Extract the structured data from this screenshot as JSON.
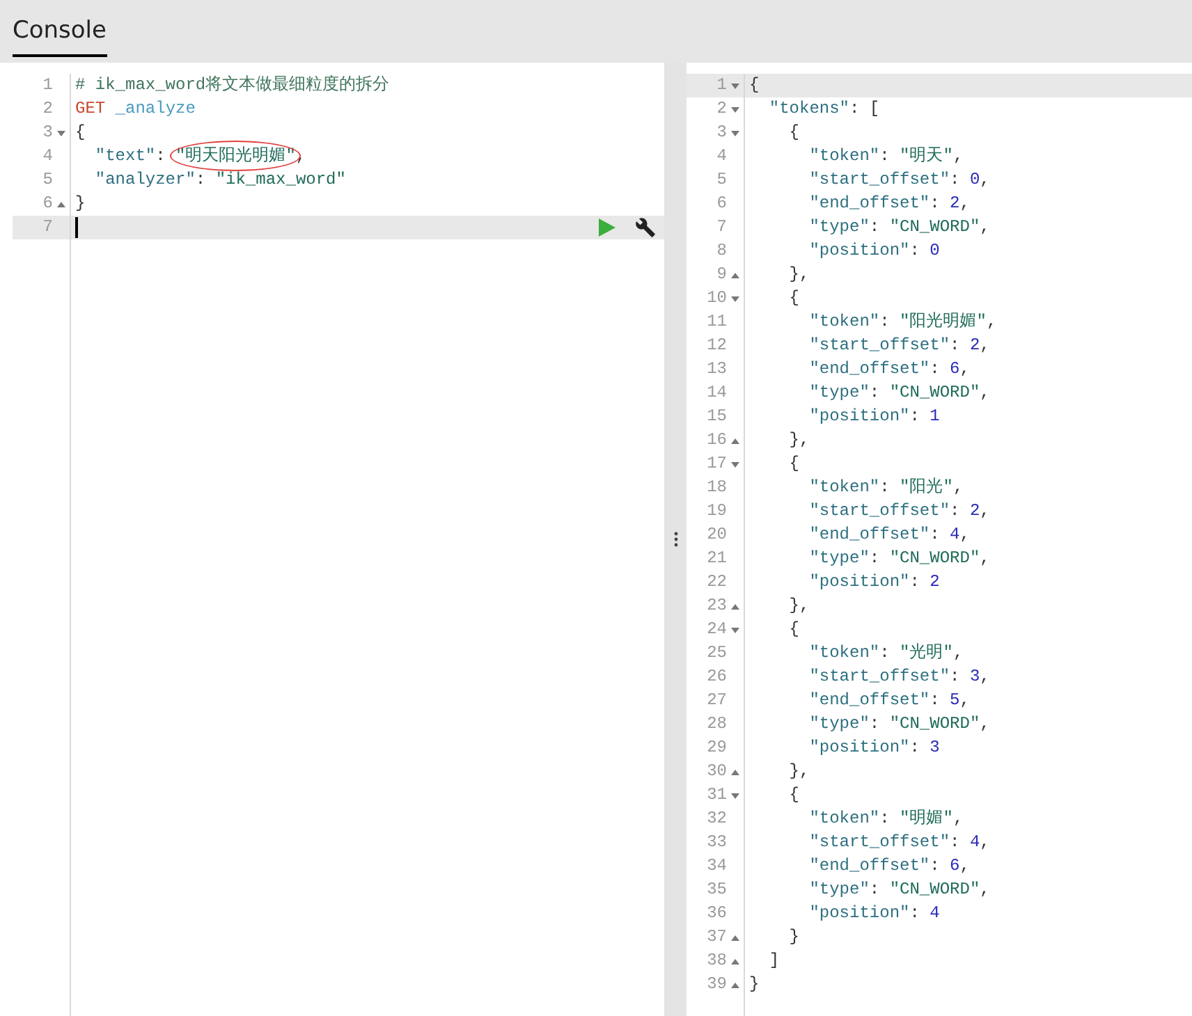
{
  "tabs": [
    {
      "label": "Console",
      "selected": true
    }
  ],
  "request_editor": {
    "lines": [
      {
        "number": "1",
        "fold_start": false,
        "fold_end": false,
        "active": false,
        "segments": [
          {
            "text": "# ik_max_word将文本做最细粒度的拆分",
            "kind": "comment"
          }
        ]
      },
      {
        "number": "2",
        "fold_start": false,
        "fold_end": false,
        "active": false,
        "segments": [
          {
            "text": "GET",
            "kind": "method"
          },
          {
            "text": " _analyze",
            "kind": "url"
          }
        ]
      },
      {
        "number": "3",
        "fold_start": true,
        "fold_end": false,
        "active": false,
        "segments": [
          {
            "text": "{",
            "kind": "punct"
          }
        ]
      },
      {
        "number": "4",
        "fold_start": false,
        "fold_end": false,
        "active": false,
        "segments": [
          {
            "text": "  \"text\"",
            "kind": "key"
          },
          {
            "text": ": ",
            "kind": "punct"
          },
          {
            "text": "\"明天阳光明媚\"",
            "kind": "string",
            "circled": true
          },
          {
            "text": ",",
            "kind": "punct"
          }
        ]
      },
      {
        "number": "5",
        "fold_start": false,
        "fold_end": false,
        "active": false,
        "segments": [
          {
            "text": "  \"analyzer\"",
            "kind": "key"
          },
          {
            "text": ": ",
            "kind": "punct"
          },
          {
            "text": "\"ik_max_word\"",
            "kind": "string"
          }
        ]
      },
      {
        "number": "6",
        "fold_start": false,
        "fold_end": true,
        "active": false,
        "segments": [
          {
            "text": "}",
            "kind": "punct"
          }
        ]
      },
      {
        "number": "7",
        "fold_start": false,
        "fold_end": false,
        "active": true
      }
    ]
  },
  "response_editor": {
    "lines": [
      {
        "number": "1",
        "fold_start": true,
        "fold_end": false,
        "active": true,
        "segments": [
          {
            "text": "{",
            "kind": "punct"
          }
        ]
      },
      {
        "number": "2",
        "fold_start": true,
        "fold_end": false,
        "active": false,
        "segments": [
          {
            "text": "  \"tokens\"",
            "kind": "key"
          },
          {
            "text": ": [",
            "kind": "punct"
          }
        ]
      },
      {
        "number": "3",
        "fold_start": true,
        "fold_end": false,
        "active": false,
        "segments": [
          {
            "text": "    {",
            "kind": "punct"
          }
        ]
      },
      {
        "number": "4",
        "fold_start": false,
        "fold_end": false,
        "active": false,
        "segments": [
          {
            "text": "      \"token\"",
            "kind": "key"
          },
          {
            "text": ": ",
            "kind": "punct"
          },
          {
            "text": "\"明天\"",
            "kind": "string"
          },
          {
            "text": ",",
            "kind": "punct"
          }
        ]
      },
      {
        "number": "5",
        "fold_start": false,
        "fold_end": false,
        "active": false,
        "segments": [
          {
            "text": "      \"start_offset\"",
            "kind": "key"
          },
          {
            "text": ": ",
            "kind": "punct"
          },
          {
            "text": "0",
            "kind": "number"
          },
          {
            "text": ",",
            "kind": "punct"
          }
        ]
      },
      {
        "number": "6",
        "fold_start": false,
        "fold_end": false,
        "active": false,
        "segments": [
          {
            "text": "      \"end_offset\"",
            "kind": "key"
          },
          {
            "text": ": ",
            "kind": "punct"
          },
          {
            "text": "2",
            "kind": "number"
          },
          {
            "text": ",",
            "kind": "punct"
          }
        ]
      },
      {
        "number": "7",
        "fold_start": false,
        "fold_end": false,
        "active": false,
        "segments": [
          {
            "text": "      \"type\"",
            "kind": "key"
          },
          {
            "text": ": ",
            "kind": "punct"
          },
          {
            "text": "\"CN_WORD\"",
            "kind": "string"
          },
          {
            "text": ",",
            "kind": "punct"
          }
        ]
      },
      {
        "number": "8",
        "fold_start": false,
        "fold_end": false,
        "active": false,
        "segments": [
          {
            "text": "      \"position\"",
            "kind": "key"
          },
          {
            "text": ": ",
            "kind": "punct"
          },
          {
            "text": "0",
            "kind": "number"
          }
        ]
      },
      {
        "number": "9",
        "fold_start": false,
        "fold_end": true,
        "active": false,
        "segments": [
          {
            "text": "    },",
            "kind": "punct"
          }
        ]
      },
      {
        "number": "10",
        "fold_start": true,
        "fold_end": false,
        "active": false,
        "segments": [
          {
            "text": "    {",
            "kind": "punct"
          }
        ]
      },
      {
        "number": "11",
        "fold_start": false,
        "fold_end": false,
        "active": false,
        "segments": [
          {
            "text": "      \"token\"",
            "kind": "key"
          },
          {
            "text": ": ",
            "kind": "punct"
          },
          {
            "text": "\"阳光明媚\"",
            "kind": "string"
          },
          {
            "text": ",",
            "kind": "punct"
          }
        ]
      },
      {
        "number": "12",
        "fold_start": false,
        "fold_end": false,
        "active": false,
        "segments": [
          {
            "text": "      \"start_offset\"",
            "kind": "key"
          },
          {
            "text": ": ",
            "kind": "punct"
          },
          {
            "text": "2",
            "kind": "number"
          },
          {
            "text": ",",
            "kind": "punct"
          }
        ]
      },
      {
        "number": "13",
        "fold_start": false,
        "fold_end": false,
        "active": false,
        "segments": [
          {
            "text": "      \"end_offset\"",
            "kind": "key"
          },
          {
            "text": ": ",
            "kind": "punct"
          },
          {
            "text": "6",
            "kind": "number"
          },
          {
            "text": ",",
            "kind": "punct"
          }
        ]
      },
      {
        "number": "14",
        "fold_start": false,
        "fold_end": false,
        "active": false,
        "segments": [
          {
            "text": "      \"type\"",
            "kind": "key"
          },
          {
            "text": ": ",
            "kind": "punct"
          },
          {
            "text": "\"CN_WORD\"",
            "kind": "string"
          },
          {
            "text": ",",
            "kind": "punct"
          }
        ]
      },
      {
        "number": "15",
        "fold_start": false,
        "fold_end": false,
        "active": false,
        "segments": [
          {
            "text": "      \"position\"",
            "kind": "key"
          },
          {
            "text": ": ",
            "kind": "punct"
          },
          {
            "text": "1",
            "kind": "number"
          }
        ]
      },
      {
        "number": "16",
        "fold_start": false,
        "fold_end": true,
        "active": false,
        "segments": [
          {
            "text": "    },",
            "kind": "punct"
          }
        ]
      },
      {
        "number": "17",
        "fold_start": true,
        "fold_end": false,
        "active": false,
        "segments": [
          {
            "text": "    {",
            "kind": "punct"
          }
        ]
      },
      {
        "number": "18",
        "fold_start": false,
        "fold_end": false,
        "active": false,
        "segments": [
          {
            "text": "      \"token\"",
            "kind": "key"
          },
          {
            "text": ": ",
            "kind": "punct"
          },
          {
            "text": "\"阳光\"",
            "kind": "string"
          },
          {
            "text": ",",
            "kind": "punct"
          }
        ]
      },
      {
        "number": "19",
        "fold_start": false,
        "fold_end": false,
        "active": false,
        "segments": [
          {
            "text": "      \"start_offset\"",
            "kind": "key"
          },
          {
            "text": ": ",
            "kind": "punct"
          },
          {
            "text": "2",
            "kind": "number"
          },
          {
            "text": ",",
            "kind": "punct"
          }
        ]
      },
      {
        "number": "20",
        "fold_start": false,
        "fold_end": false,
        "active": false,
        "segments": [
          {
            "text": "      \"end_offset\"",
            "kind": "key"
          },
          {
            "text": ": ",
            "kind": "punct"
          },
          {
            "text": "4",
            "kind": "number"
          },
          {
            "text": ",",
            "kind": "punct"
          }
        ]
      },
      {
        "number": "21",
        "fold_start": false,
        "fold_end": false,
        "active": false,
        "segments": [
          {
            "text": "      \"type\"",
            "kind": "key"
          },
          {
            "text": ": ",
            "kind": "punct"
          },
          {
            "text": "\"CN_WORD\"",
            "kind": "string"
          },
          {
            "text": ",",
            "kind": "punct"
          }
        ]
      },
      {
        "number": "22",
        "fold_start": false,
        "fold_end": false,
        "active": false,
        "segments": [
          {
            "text": "      \"position\"",
            "kind": "key"
          },
          {
            "text": ": ",
            "kind": "punct"
          },
          {
            "text": "2",
            "kind": "number"
          }
        ]
      },
      {
        "number": "23",
        "fold_start": false,
        "fold_end": true,
        "active": false,
        "segments": [
          {
            "text": "    },",
            "kind": "punct"
          }
        ]
      },
      {
        "number": "24",
        "fold_start": true,
        "fold_end": false,
        "active": false,
        "segments": [
          {
            "text": "    {",
            "kind": "punct"
          }
        ]
      },
      {
        "number": "25",
        "fold_start": false,
        "fold_end": false,
        "active": false,
        "segments": [
          {
            "text": "      \"token\"",
            "kind": "key"
          },
          {
            "text": ": ",
            "kind": "punct"
          },
          {
            "text": "\"光明\"",
            "kind": "string"
          },
          {
            "text": ",",
            "kind": "punct"
          }
        ]
      },
      {
        "number": "26",
        "fold_start": false,
        "fold_end": false,
        "active": false,
        "segments": [
          {
            "text": "      \"start_offset\"",
            "kind": "key"
          },
          {
            "text": ": ",
            "kind": "punct"
          },
          {
            "text": "3",
            "kind": "number"
          },
          {
            "text": ",",
            "kind": "punct"
          }
        ]
      },
      {
        "number": "27",
        "fold_start": false,
        "fold_end": false,
        "active": false,
        "segments": [
          {
            "text": "      \"end_offset\"",
            "kind": "key"
          },
          {
            "text": ": ",
            "kind": "punct"
          },
          {
            "text": "5",
            "kind": "number"
          },
          {
            "text": ",",
            "kind": "punct"
          }
        ]
      },
      {
        "number": "28",
        "fold_start": false,
        "fold_end": false,
        "active": false,
        "segments": [
          {
            "text": "      \"type\"",
            "kind": "key"
          },
          {
            "text": ": ",
            "kind": "punct"
          },
          {
            "text": "\"CN_WORD\"",
            "kind": "string"
          },
          {
            "text": ",",
            "kind": "punct"
          }
        ]
      },
      {
        "number": "29",
        "fold_start": false,
        "fold_end": false,
        "active": false,
        "segments": [
          {
            "text": "      \"position\"",
            "kind": "key"
          },
          {
            "text": ": ",
            "kind": "punct"
          },
          {
            "text": "3",
            "kind": "number"
          }
        ]
      },
      {
        "number": "30",
        "fold_start": false,
        "fold_end": true,
        "active": false,
        "segments": [
          {
            "text": "    },",
            "kind": "punct"
          }
        ]
      },
      {
        "number": "31",
        "fold_start": true,
        "fold_end": false,
        "active": false,
        "segments": [
          {
            "text": "    {",
            "kind": "punct"
          }
        ]
      },
      {
        "number": "32",
        "fold_start": false,
        "fold_end": false,
        "active": false,
        "segments": [
          {
            "text": "      \"token\"",
            "kind": "key"
          },
          {
            "text": ": ",
            "kind": "punct"
          },
          {
            "text": "\"明媚\"",
            "kind": "string"
          },
          {
            "text": ",",
            "kind": "punct"
          }
        ]
      },
      {
        "number": "33",
        "fold_start": false,
        "fold_end": false,
        "active": false,
        "segments": [
          {
            "text": "      \"start_offset\"",
            "kind": "key"
          },
          {
            "text": ": ",
            "kind": "punct"
          },
          {
            "text": "4",
            "kind": "number"
          },
          {
            "text": ",",
            "kind": "punct"
          }
        ]
      },
      {
        "number": "34",
        "fold_start": false,
        "fold_end": false,
        "active": false,
        "segments": [
          {
            "text": "      \"end_offset\"",
            "kind": "key"
          },
          {
            "text": ": ",
            "kind": "punct"
          },
          {
            "text": "6",
            "kind": "number"
          },
          {
            "text": ",",
            "kind": "punct"
          }
        ]
      },
      {
        "number": "35",
        "fold_start": false,
        "fold_end": false,
        "active": false,
        "segments": [
          {
            "text": "      \"type\"",
            "kind": "key"
          },
          {
            "text": ": ",
            "kind": "punct"
          },
          {
            "text": "\"CN_WORD\"",
            "kind": "string"
          },
          {
            "text": ",",
            "kind": "punct"
          }
        ]
      },
      {
        "number": "36",
        "fold_start": false,
        "fold_end": false,
        "active": false,
        "segments": [
          {
            "text": "      \"position\"",
            "kind": "key"
          },
          {
            "text": ": ",
            "kind": "punct"
          },
          {
            "text": "4",
            "kind": "number"
          }
        ]
      },
      {
        "number": "37",
        "fold_start": false,
        "fold_end": true,
        "active": false,
        "segments": [
          {
            "text": "    }",
            "kind": "punct"
          }
        ]
      },
      {
        "number": "38",
        "fold_start": false,
        "fold_end": true,
        "active": false,
        "segments": [
          {
            "text": "  ]",
            "kind": "punct"
          }
        ]
      },
      {
        "number": "39",
        "fold_start": false,
        "fold_end": true,
        "active": false,
        "segments": [
          {
            "text": "}",
            "kind": "punct"
          }
        ]
      }
    ]
  }
}
